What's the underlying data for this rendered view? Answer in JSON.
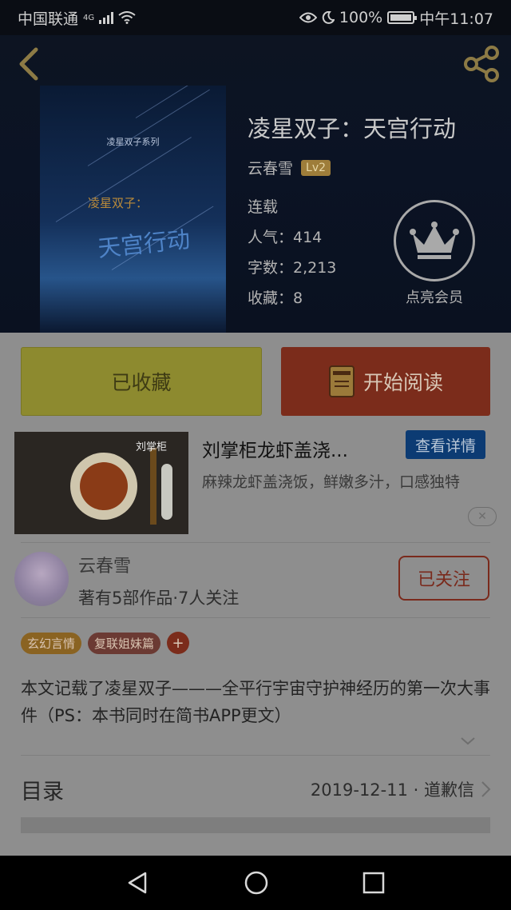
{
  "status_bar": {
    "carrier": "中国联通",
    "network": "4G",
    "battery": "100%",
    "time": "中午11:07"
  },
  "header": {
    "back_icon": "back-arrow-icon",
    "share_icon": "share-icon",
    "cover": {
      "series": "凌星双子系列",
      "subtitle": "凌星双子：",
      "title": "天宫行动"
    },
    "book_title": "凌星双子：天宫行动",
    "author": "云春雪",
    "level": "Lv2",
    "status": "连载",
    "popularity": "人气：414",
    "word_count": "字数：2,213",
    "favorites": "收藏：8",
    "vip_label": "点亮会员",
    "vip_icon": "crown-icon"
  },
  "actions": {
    "favorited": "已收藏",
    "start_reading": "开始阅读",
    "read_icon": "book-icon"
  },
  "ad": {
    "brand": "刘掌柜",
    "title": "刘掌柜龙虾盖浇...",
    "detail_button": "查看详情",
    "description": "麻辣龙虾盖浇饭，鲜嫩多汁，口感独特",
    "close": "✕"
  },
  "author_card": {
    "name": "云春雪",
    "works": "著有5部作品·7人关注",
    "follow_button": "已关注"
  },
  "tags": [
    {
      "label": "玄幻言情",
      "color": "#8a6322"
    },
    {
      "label": "复联姐妹篇",
      "color": "#6b3a33"
    }
  ],
  "tag_add": "+",
  "synopsis": "本文记载了凌星双子———全平行宇宙守护神经历的第一次大事件（PS：本书同时在简书APP更文）",
  "toc": {
    "title": "目录",
    "latest": "2019-12-11 · 道歉信"
  },
  "navbar": {
    "back": "nav-back-icon",
    "home": "nav-home-icon",
    "recents": "nav-recents-icon"
  }
}
